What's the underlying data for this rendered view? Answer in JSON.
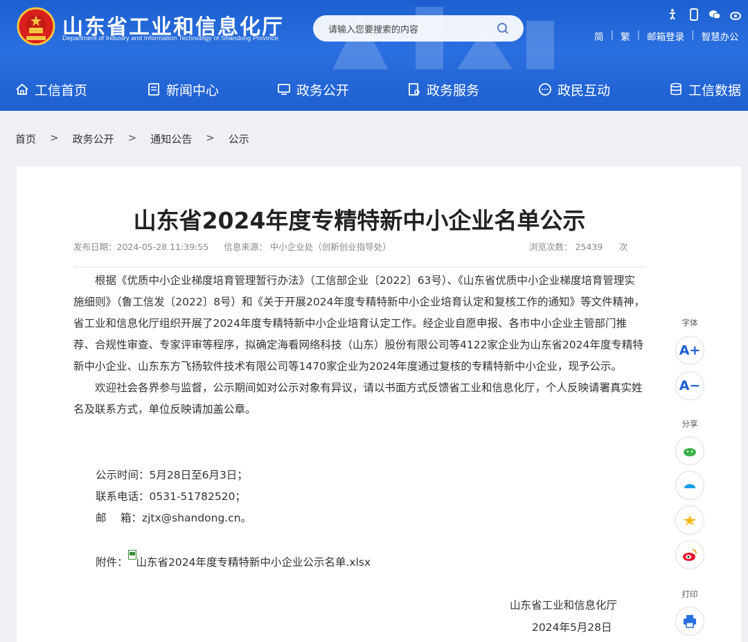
{
  "header": {
    "title": "山东省工业和信息化厅",
    "subtitle": "Department of Industry and Information Technology of Shandong Province",
    "search_placeholder": "请输入您要搜索的内容",
    "links": [
      "简",
      "繁",
      "邮箱登录",
      "智慧办公"
    ],
    "icons": [
      "accessibility-icon",
      "mobile-icon",
      "wechat-icon",
      "weibo-icon"
    ]
  },
  "nav": {
    "items": [
      {
        "label": "工信首页",
        "icon": "home-icon"
      },
      {
        "label": "新闻中心",
        "icon": "news-icon"
      },
      {
        "label": "政务公开",
        "icon": "monitor-icon"
      },
      {
        "label": "政务服务",
        "icon": "service-icon"
      },
      {
        "label": "政民互动",
        "icon": "chat-icon"
      },
      {
        "label": "工信数据",
        "icon": "database-icon"
      }
    ]
  },
  "breadcrumb": {
    "items": [
      "首页",
      "政务公开",
      "通知公告",
      "公示"
    ],
    "sep": ">"
  },
  "article": {
    "title": "山东省2024年度专精特新中小企业名单公示",
    "publish": "发布日期：2024-05-28 11:39:55",
    "source": "信息来源： 中小企业处（创新创业指导处）",
    "views_label": "浏览次数： 25439",
    "views_unit": "次",
    "para1": "根据《优质中小企业梯度培育管理暂行办法》（工信部企业〔2022〕63号）、《山东省优质中小企业梯度培育管理实施细则》（鲁工信发〔2022〕8号）和《关于开展2024年度专精特新中小企业培育认定和复核工作的通知》等文件精神，省工业和信息化厅组织开展了2024年度专精特新中小企业培育认定工作。经企业自愿申报、各市中小企业主管部门推荐、合规性审查、专家评审等程序，拟确定海看网络科技（山东）股份有限公司等4122家企业为山东省2024年度专精特新中小企业、山东东方飞扬软件技术有限公司等1470家企业为2024年度通过复核的专精特新中小企业，现予公示。",
    "para2": "欢迎社会各界参与监督，公示期间如对公示对象有异议，请以书面方式反馈省工业和信息化厅，个人反映请署真实姓名及联系方式，单位反映请加盖公章。",
    "period": "公示时间：5月28日至6月3日；",
    "phone": "联系电话：0531-51782520；",
    "email": "邮　 箱：zjtx@shandong.cn。",
    "attach_label": "附件：",
    "attach_file": "山东省2024年度专精特新中小企业公示名单.xlsx",
    "sign_org": "山东省工业和信息化厅",
    "sign_date": "2024年5月28日"
  },
  "side": {
    "font_label": "字体",
    "font_up": "A+",
    "font_down": "A−",
    "share_label": "分享",
    "print_label": "打印"
  },
  "colors": {
    "brand": "#1f5fcf",
    "text": "#333333",
    "meta": "#888888"
  }
}
